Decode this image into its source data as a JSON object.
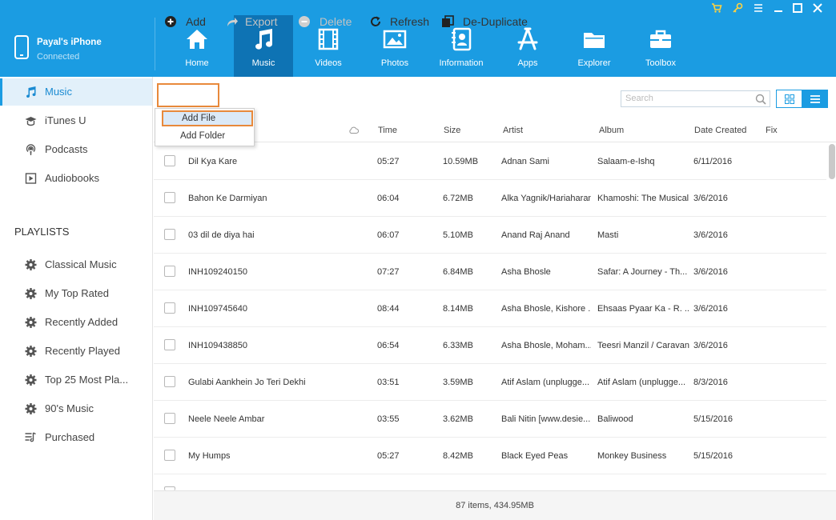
{
  "colors": {
    "accent": "#1b9ce2",
    "nav_active": "#0e73b4",
    "highlight": "#e8893b"
  },
  "device": {
    "name": "Payal's iPhone",
    "status": "Connected"
  },
  "nav": [
    {
      "label": "Home",
      "icon": "home-icon"
    },
    {
      "label": "Music",
      "icon": "music-note-icon"
    },
    {
      "label": "Videos",
      "icon": "film-icon"
    },
    {
      "label": "Photos",
      "icon": "photo-icon"
    },
    {
      "label": "Information",
      "icon": "contacts-icon"
    },
    {
      "label": "Apps",
      "icon": "app-store-icon"
    },
    {
      "label": "Explorer",
      "icon": "folder-icon"
    },
    {
      "label": "Toolbox",
      "icon": "toolbox-icon"
    }
  ],
  "window_controls": [
    "cart-icon",
    "key-icon",
    "menu-icon",
    "minimize-icon",
    "maximize-icon",
    "close-icon"
  ],
  "sidebar": {
    "library": [
      {
        "label": "Music",
        "icon": "music-note-icon"
      },
      {
        "label": "iTunes U",
        "icon": "graduation-cap-icon"
      },
      {
        "label": "Podcasts",
        "icon": "podcast-icon"
      },
      {
        "label": "Audiobooks",
        "icon": "audiobook-icon"
      }
    ],
    "playlists_heading": "PLAYLISTS",
    "playlists": [
      {
        "label": "Classical Music",
        "icon": "gear-icon"
      },
      {
        "label": "My Top Rated",
        "icon": "gear-icon"
      },
      {
        "label": "Recently Added",
        "icon": "gear-icon"
      },
      {
        "label": "Recently Played",
        "icon": "gear-icon"
      },
      {
        "label": "Top 25 Most Pla...",
        "icon": "gear-icon"
      },
      {
        "label": "90's Music",
        "icon": "gear-icon"
      },
      {
        "label": "Purchased",
        "icon": "playlist-icon"
      }
    ]
  },
  "toolbar": {
    "add": "Add",
    "export": "Export",
    "delete": "Delete",
    "refresh": "Refresh",
    "deduplicate": "De-Duplicate",
    "search_placeholder": "Search"
  },
  "add_menu": {
    "add_file": "Add File",
    "add_folder": "Add Folder"
  },
  "table": {
    "columns": {
      "time": "Time",
      "size": "Size",
      "artist": "Artist",
      "album": "Album",
      "date_created": "Date Created",
      "fix": "Fix"
    },
    "rows": [
      {
        "name": "Dil Kya Kare",
        "time": "05:27",
        "size": "10.59MB",
        "artist": "Adnan Sami",
        "album": "Salaam-e-Ishq",
        "date": "6/11/2016"
      },
      {
        "name": "Bahon Ke Darmiyan",
        "time": "06:04",
        "size": "6.72MB",
        "artist": "Alka Yagnik/Hariaharan",
        "album": "Khamoshi: The Musical",
        "date": "3/6/2016"
      },
      {
        "name": "03 dil de diya hai",
        "time": "06:07",
        "size": "5.10MB",
        "artist": "Anand Raj Anand",
        "album": "Masti",
        "date": "3/6/2016"
      },
      {
        "name": "INH109240150",
        "time": "07:27",
        "size": "6.84MB",
        "artist": "Asha Bhosle",
        "album": "Safar: A Journey - Th...",
        "date": "3/6/2016"
      },
      {
        "name": "INH109745640",
        "time": "08:44",
        "size": "8.14MB",
        "artist": "Asha Bhosle, Kishore ...",
        "album": "Ehsaas Pyaar Ka - R. ...",
        "date": "3/6/2016"
      },
      {
        "name": "INH109438850",
        "time": "06:54",
        "size": "6.33MB",
        "artist": "Asha Bhosle, Moham...",
        "album": "Teesri Manzil / Caravan",
        "date": "3/6/2016"
      },
      {
        "name": "Gulabi Aankhein Jo Teri Dekhi",
        "time": "03:51",
        "size": "3.59MB",
        "artist": "Atif Aslam (unplugge...",
        "album": "Atif Aslam (unplugge...",
        "date": "8/3/2016"
      },
      {
        "name": "Neele Neele Ambar",
        "time": "03:55",
        "size": "3.62MB",
        "artist": "Bali Nitin [www.desie...",
        "album": "Baliwood",
        "date": "5/15/2016"
      },
      {
        "name": "My Humps",
        "time": "05:27",
        "size": "8.42MB",
        "artist": "Black Eyed Peas",
        "album": "Monkey Business",
        "date": "5/15/2016"
      }
    ]
  },
  "footer": {
    "summary": "87 items, 434.95MB"
  }
}
